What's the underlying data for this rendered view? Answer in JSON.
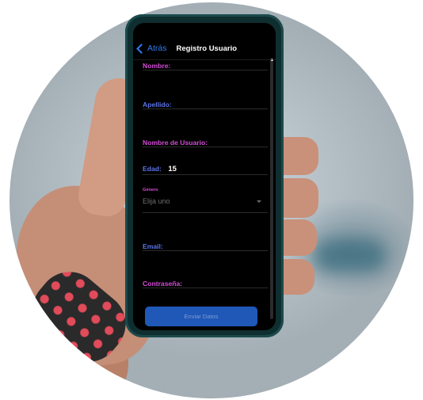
{
  "navbar": {
    "back_label": "Atrás",
    "title": "Registro Usuario"
  },
  "form": {
    "fields": [
      {
        "label": "Nombre:",
        "value": ""
      },
      {
        "label": "Apellido:",
        "value": ""
      },
      {
        "label": "Nombre de Usuario:",
        "value": ""
      },
      {
        "label": "Edad:",
        "value": "15"
      },
      {
        "label": "Email:",
        "value": ""
      },
      {
        "label": "Contraseña:",
        "value": ""
      }
    ],
    "genero": {
      "caption": "Género",
      "placeholder": "Elija uno"
    },
    "submit_label": "Enviar Datos"
  },
  "colors": {
    "label_magenta": "#d34cd6",
    "label_blue": "#5c73e6",
    "accent_blue": "#2f7df6",
    "button_bg": "#1f58b7"
  },
  "icons": {
    "back": "chevron-left-icon",
    "dropdown": "caret-down-icon"
  }
}
